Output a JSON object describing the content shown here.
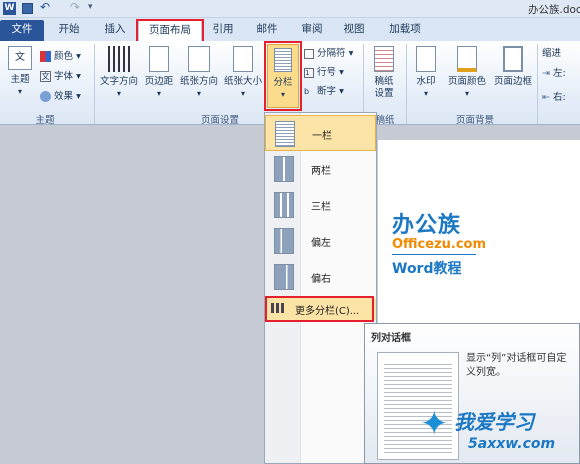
{
  "window": {
    "title": "办公族.doc"
  },
  "tabs": [
    "文件",
    "开始",
    "插入",
    "页面布局",
    "引用",
    "邮件",
    "审阅",
    "视图",
    "加载项"
  ],
  "ribbon": {
    "theme_group": {
      "label": "主题",
      "themes": "主题",
      "colors": "颜色",
      "fonts": "字体",
      "effects": "效果"
    },
    "page_setup": {
      "label": "页面设置",
      "text_direction": "文字方向",
      "margins": "页边距",
      "orientation": "纸张方向",
      "size": "纸张大小",
      "columns": "分栏",
      "breaks": "分隔符",
      "line_numbers": "行号",
      "hyphenation": "断字"
    },
    "draft": {
      "label": "稿纸",
      "button": "稿纸\n设置"
    },
    "background": {
      "label": "页面背景",
      "watermark": "水印",
      "page_color": "页面颜色",
      "page_border": "页面边框"
    },
    "indent": {
      "label": "缩进",
      "left": "左:",
      "right": "右:"
    }
  },
  "columns_menu": {
    "items": [
      "一栏",
      "两栏",
      "三栏",
      "偏左",
      "偏右"
    ],
    "more": "更多分栏(C)..."
  },
  "tooltip": {
    "title": "列对话框",
    "body": "显示“列”对话框可自定义列宽。"
  },
  "document": {
    "brand_cn": "办公族",
    "brand_url": "Officezu.com",
    "brand_sub": "Word教程"
  },
  "watermark": {
    "text": "我爱学习",
    "url": "5axxw.com"
  },
  "colors": {
    "file_tab": "#2a5699",
    "accent": "#1b78c4",
    "orange": "#f08a00",
    "highlight": "#e5202e"
  }
}
